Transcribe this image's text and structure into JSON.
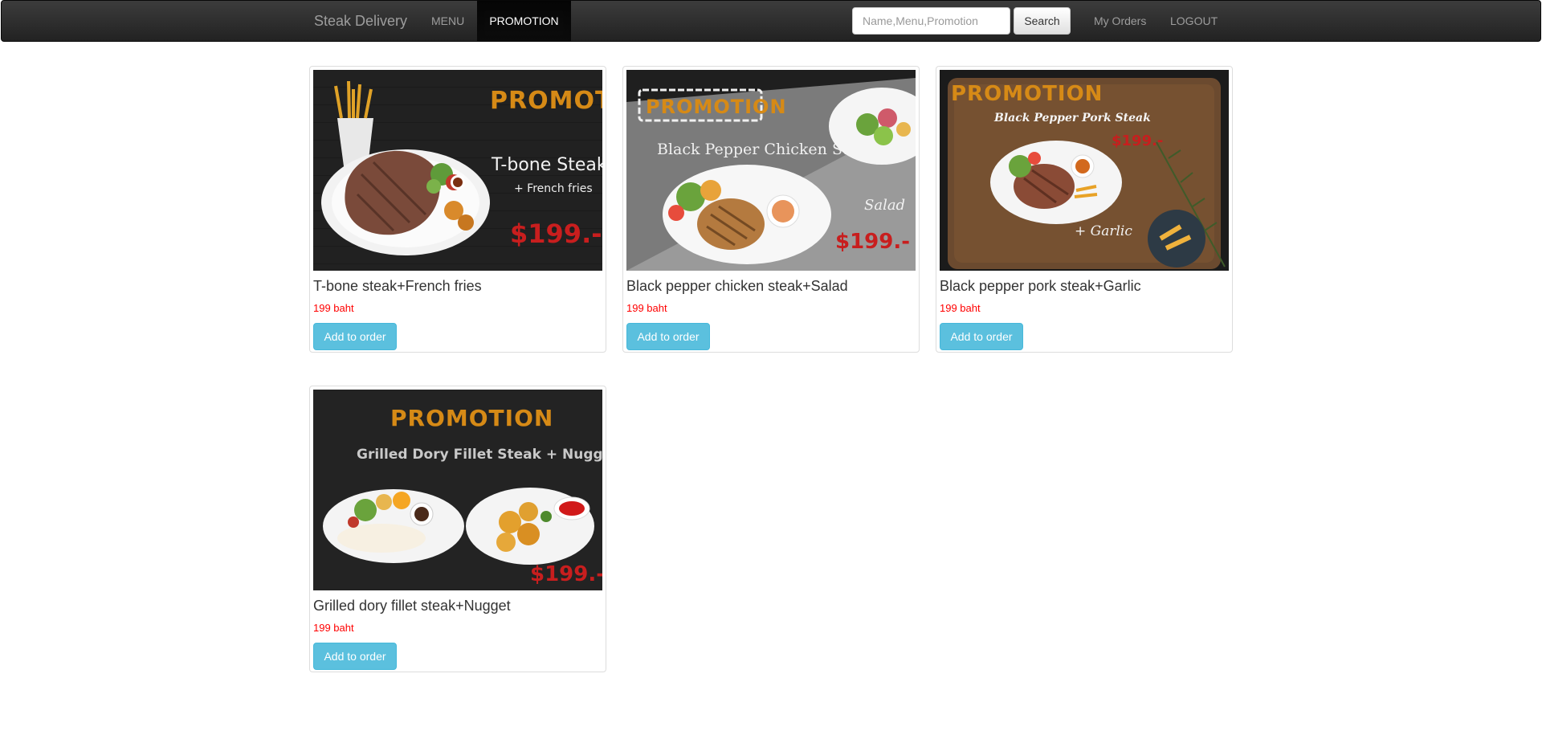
{
  "navbar": {
    "brand": "Steak Delivery",
    "links": [
      "MENU",
      "PROMOTION"
    ],
    "active_link": "PROMOTION",
    "search_placeholder": "Name,Menu,Promotion",
    "search_button": "Search",
    "right_links": [
      "My Orders",
      "LOGOUT"
    ]
  },
  "colors": {
    "navbar_bg": "#222222",
    "price": "#ff0000",
    "button": "#5bc0de"
  },
  "products": [
    {
      "name": "T-bone steak+French fries",
      "price": "199 baht",
      "button": "Add to order",
      "banner": {
        "promo": "PROMOTION",
        "title": "T-bone Steak",
        "subtitle": "+ French fries",
        "price": "$199.-"
      }
    },
    {
      "name": "Black pepper chicken steak+Salad",
      "price": "199 baht",
      "button": "Add to order",
      "banner": {
        "promo": "PROMOTION",
        "title": "Black Pepper Chicken Steak",
        "subtitle": "Salad",
        "price": "$199.-"
      }
    },
    {
      "name": "Black pepper pork steak+Garlic",
      "price": "199 baht",
      "button": "Add to order",
      "banner": {
        "promo": "PROMOTION",
        "title": "Black Pepper Pork Steak",
        "subtitle": "+ Garlic",
        "price": "$199.-"
      }
    },
    {
      "name": "Grilled dory fillet steak+Nugget",
      "price": "199 baht",
      "button": "Add to order",
      "banner": {
        "promo": "PROMOTION",
        "title": "Grilled Dory Fillet Steak + Nugget",
        "subtitle": "",
        "price": "$199.-"
      }
    }
  ]
}
